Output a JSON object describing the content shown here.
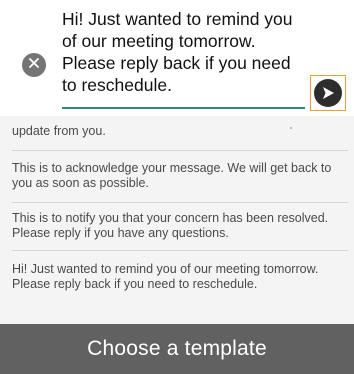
{
  "composer": {
    "message_text": "Hi! Just wanted to remind you of our meeting tomorrow. Please reply back if you need to reschedule.",
    "clear_icon": "close-icon",
    "send_icon": "send-arrow-icon",
    "accent_color": "#2a8c7e",
    "focus_color": "#f29c38"
  },
  "templates": {
    "items": [
      {
        "text": "update from you."
      },
      {
        "text": "This is to acknowledge your message. We will get back to you as soon as possible."
      },
      {
        "text": "This is to notify you that your concern has been resolved. Please reply if you have any questions."
      },
      {
        "text": "Hi! Just wanted to remind you of our meeting tomorrow. Please reply back if you need to reschedule."
      }
    ]
  },
  "footer": {
    "choose_label": "Choose a template"
  }
}
